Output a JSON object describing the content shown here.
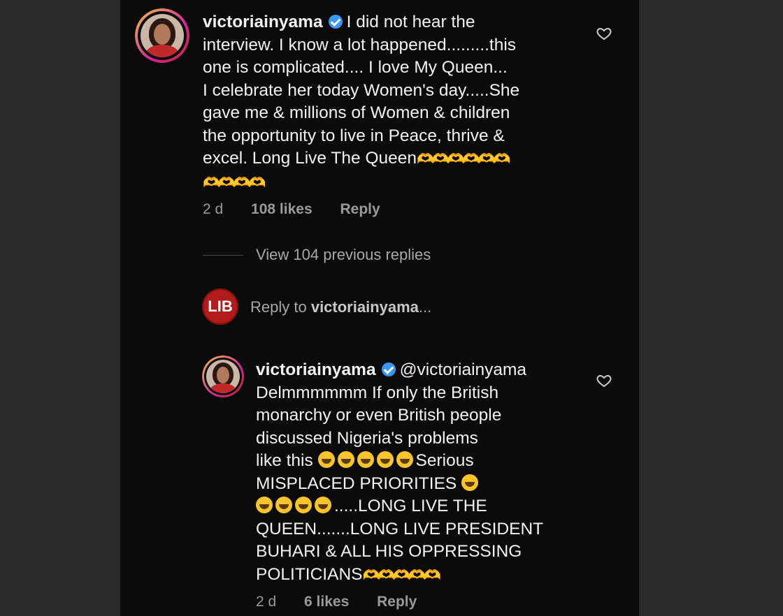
{
  "comment1": {
    "username": "victoriainyama",
    "lines": [
      "I did not hear the",
      "interview.  I know a lot happened.........this",
      "one is complicated.... I love My Queen...",
      "I celebrate her today Women's day.....She",
      "gave me & millions of Women & children",
      "the opportunity to live in Peace, thrive &",
      "excel.  Long Live The Queen"
    ],
    "time": "2 d",
    "likes": "108 likes",
    "reply_label": "Reply"
  },
  "view_replies": "View 104 previous replies",
  "reply_box": {
    "avatar_text": "LIB",
    "prefix": "Reply to ",
    "target": "victoriainyama",
    "suffix": "..."
  },
  "comment2": {
    "username": "victoriainyama",
    "mention": "@victoriainyama",
    "lines": [
      "Delmmmmmm If only the British",
      "monarchy or even British people",
      "discussed Nigeria's problems",
      "like this",
      "Serious",
      "MISPLACED PRIORITIES",
      ".....LONG LIVE THE",
      "QUEEN.......LONG LIVE PRESIDENT",
      "BUHARI & ALL HIS OPPRESSING",
      "POLITICIANS"
    ],
    "time": "2 d",
    "likes": "6 likes",
    "reply_label": "Reply"
  },
  "icons": {
    "heart": "heart-outline-icon",
    "verified": "verified-badge-icon",
    "hands_emoji": "heart-hands-emoji",
    "smile_emoji": "grinning-squint-emoji"
  },
  "colors": {
    "background": "#0b0b0b",
    "text": "#f2f2f2",
    "muted": "#9a9a9a",
    "verified": "#3897f0",
    "story_ring": "#d9a441",
    "lib_red": "#b31b1b"
  }
}
